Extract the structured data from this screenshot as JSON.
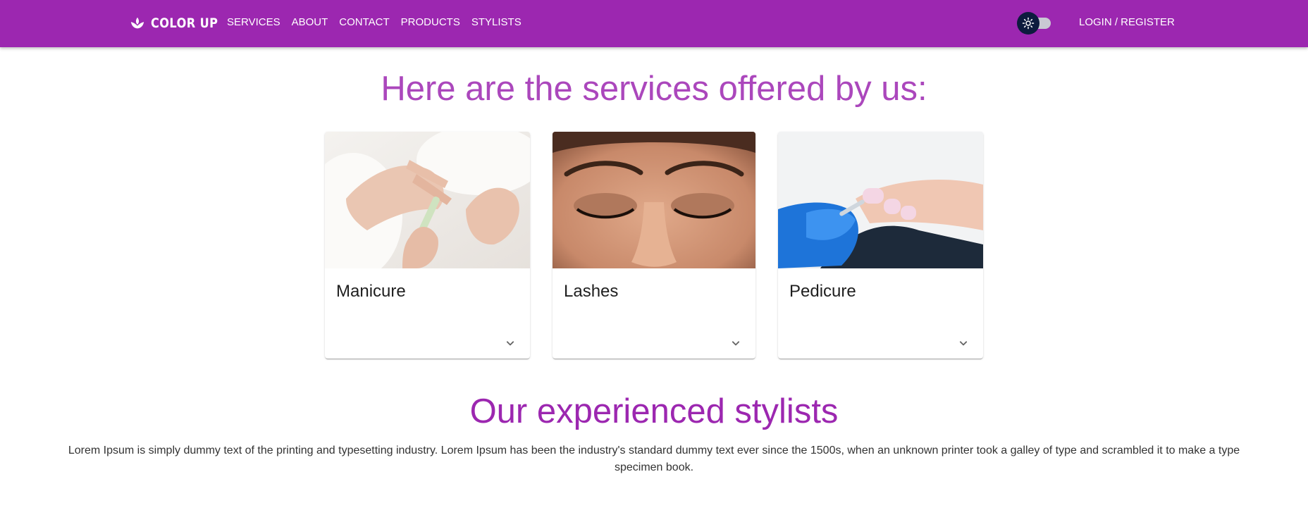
{
  "brand": {
    "name": "COLOR UP",
    "icon": "lotus-logo-icon"
  },
  "nav": {
    "items": [
      {
        "label": "SERVICES"
      },
      {
        "label": "ABOUT"
      },
      {
        "label": "CONTACT"
      },
      {
        "label": "PRODUCTS"
      },
      {
        "label": "STYLISTS"
      }
    ]
  },
  "theme_toggle": {
    "icon": "sun-icon",
    "state": "off"
  },
  "auth": {
    "label": "LOGIN / REGISTER"
  },
  "services": {
    "title": "Here are the services offered by us:",
    "cards": [
      {
        "title": "Manicure",
        "image": "manicure-photo",
        "expand_icon": "chevron-down-icon"
      },
      {
        "title": "Lashes",
        "image": "lashes-photo",
        "expand_icon": "chevron-down-icon"
      },
      {
        "title": "Pedicure",
        "image": "pedicure-photo",
        "expand_icon": "chevron-down-icon"
      }
    ]
  },
  "stylists": {
    "title": "Our experienced stylists",
    "description": "Lorem Ipsum is simply dummy text of the printing and typesetting industry. Lorem Ipsum has been the industry's standard dummy text ever since the 1500s, when an unknown printer took a galley of type and scrambled it to make a type specimen book."
  },
  "colors": {
    "appbar": "#9c27b0",
    "services_title": "#ab47bc",
    "stylists_title": "#9c27b0",
    "toggle_thumb": "#0d1b3e"
  }
}
